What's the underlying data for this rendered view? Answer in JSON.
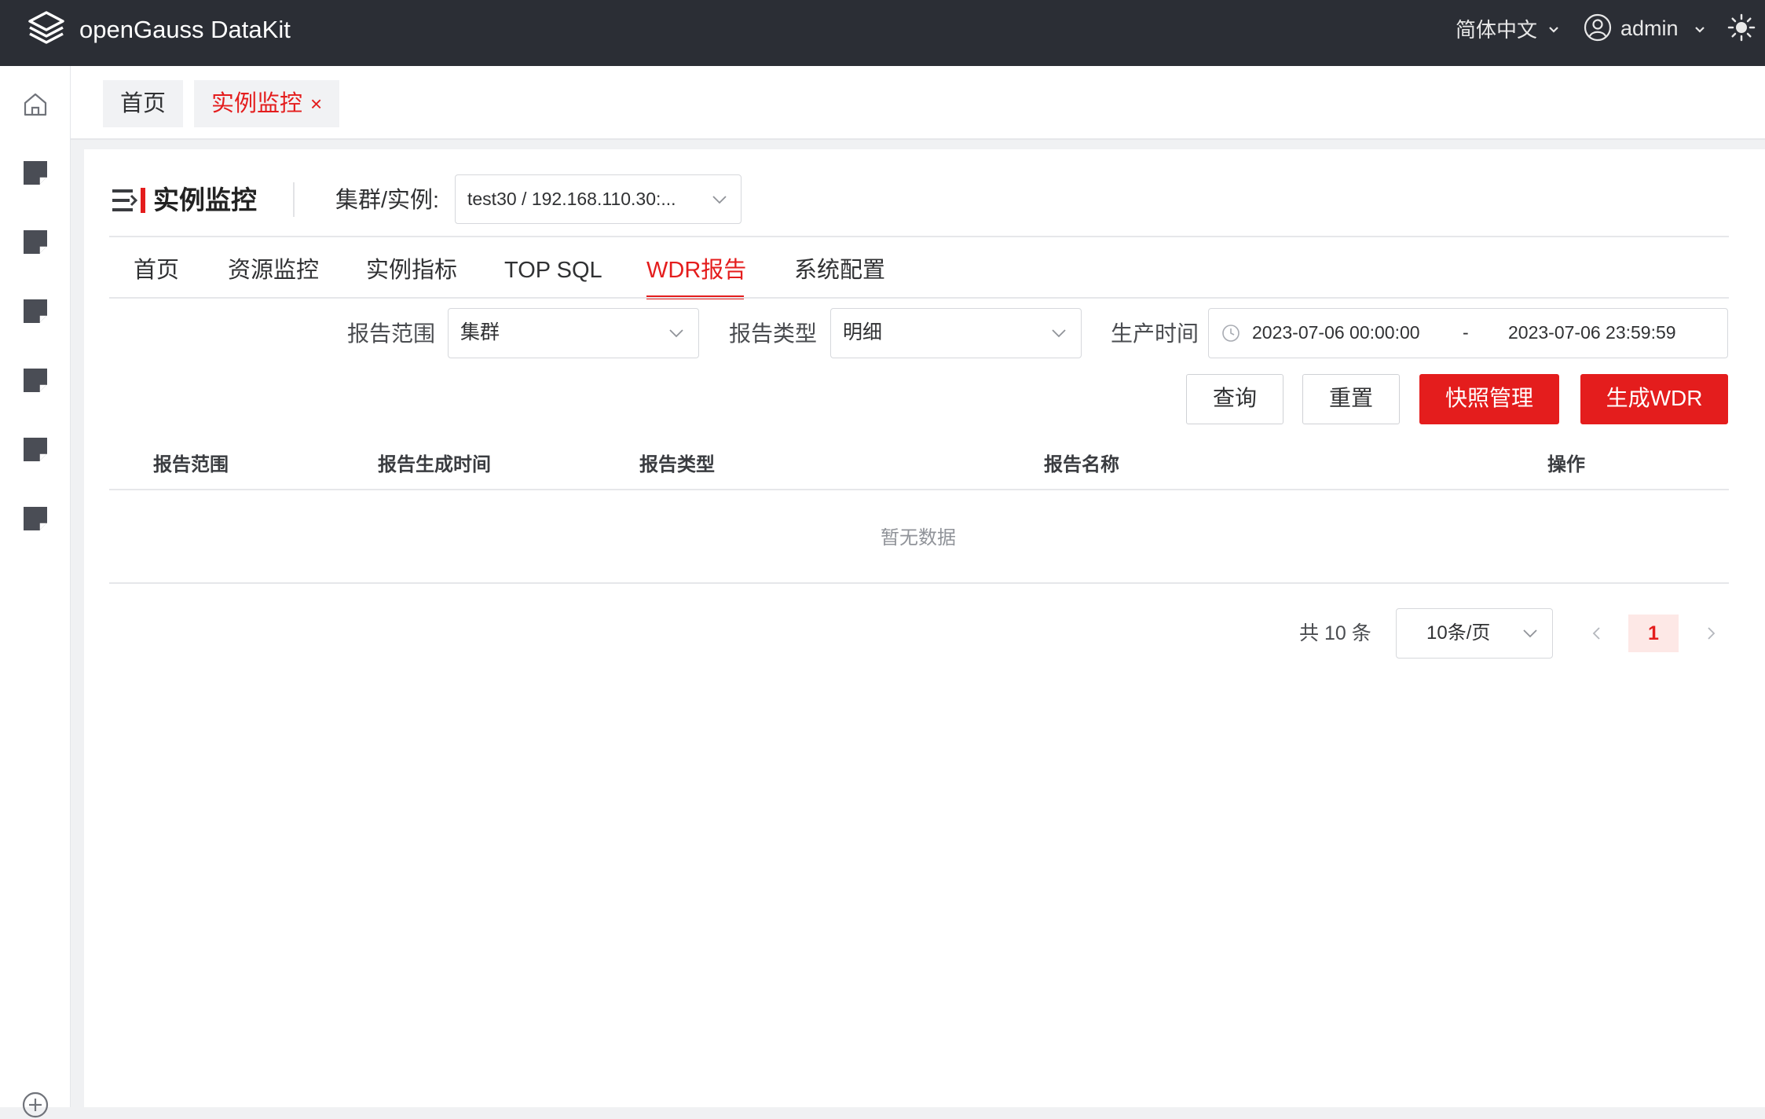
{
  "app": {
    "title": "openGauss DataKit"
  },
  "header": {
    "language": "简体中文",
    "user": "admin"
  },
  "page_tabs": [
    {
      "label": "首页"
    },
    {
      "label": "实例监控",
      "close": "×"
    }
  ],
  "page": {
    "title": "实例监控",
    "cluster_label": "集群/实例:",
    "cluster_value": "test30 / 192.168.110.30:..."
  },
  "nav_tabs": [
    {
      "label": "首页"
    },
    {
      "label": "资源监控"
    },
    {
      "label": "实例指标"
    },
    {
      "label": "TOP SQL"
    },
    {
      "label": "WDR报告",
      "active": true
    },
    {
      "label": "系统配置"
    }
  ],
  "filters": {
    "scope_label": "报告范围",
    "scope_value": "集群",
    "type_label": "报告类型",
    "type_value": "明细",
    "time_label": "生产时间",
    "time_start": "2023-07-06 00:00:00",
    "time_sep": "-",
    "time_end": "2023-07-06 23:59:59"
  },
  "buttons": {
    "query": "查询",
    "reset": "重置",
    "snapshot": "快照管理",
    "generate": "生成WDR"
  },
  "table": {
    "columns": [
      "报告范围",
      "报告生成时间",
      "报告类型",
      "报告名称",
      "操作"
    ],
    "empty": "暂无数据"
  },
  "pagination": {
    "total": "共 10 条",
    "page_size": "10条/页",
    "current": "1"
  },
  "colors": {
    "accent": "#e41d1d",
    "header_bg": "#2b2e35"
  },
  "icons": {
    "logo": "layers-logo-icon",
    "user": "user-circle-icon",
    "theme": "sun-icon",
    "home": "home-icon",
    "menu": "document-icon",
    "clock": "clock-icon"
  }
}
